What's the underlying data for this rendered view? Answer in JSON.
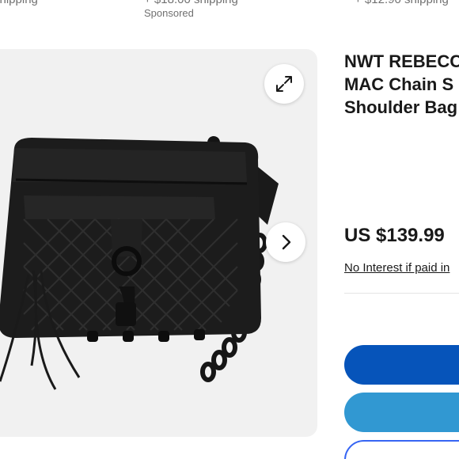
{
  "top_strip": {
    "left_shipping": "shipping",
    "mid_shipping": "+ $18.00 shipping",
    "sponsored": "Sponsored",
    "right_shipping": "+ $12.90 shipping"
  },
  "gallery": {
    "expand_icon": "expand-arrows-icon",
    "next_icon": "chevron-right-icon"
  },
  "listing": {
    "title_lines": [
      "NWT REBECCA",
      "MAC Chain S",
      "Shoulder Bag"
    ],
    "price": "US $139.99",
    "financing": "No Interest if paid in"
  },
  "actions": {
    "buy_color": "#0654ba",
    "cart_color": "#3198d2",
    "watch_border_color": "#3665f3"
  }
}
